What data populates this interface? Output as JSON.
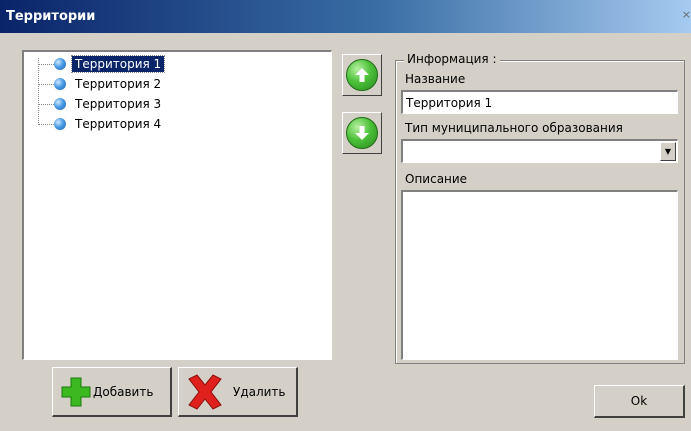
{
  "window": {
    "title": "Территории",
    "close_glyph": "×"
  },
  "tree": {
    "items": [
      {
        "label": "Территория 1",
        "selected": true
      },
      {
        "label": "Территория 2",
        "selected": false
      },
      {
        "label": "Территория 3",
        "selected": false
      },
      {
        "label": "Территория 4",
        "selected": false
      }
    ]
  },
  "move_buttons": {
    "up_icon": "arrow-up-icon",
    "down_icon": "arrow-down-icon"
  },
  "info": {
    "group_title": "Информация :",
    "name_label": "Название",
    "name_value": "Территория 1",
    "type_label": "Тип муниципального образования",
    "type_value": "",
    "description_label": "Описание",
    "description_value": ""
  },
  "buttons": {
    "add": "Добавить",
    "delete": "Удалить",
    "ok": "Ok"
  },
  "colors": {
    "accent": "#0a246a",
    "face": "#d4d0c8",
    "add_icon": "#3cb820",
    "delete_icon": "#e0201c"
  }
}
